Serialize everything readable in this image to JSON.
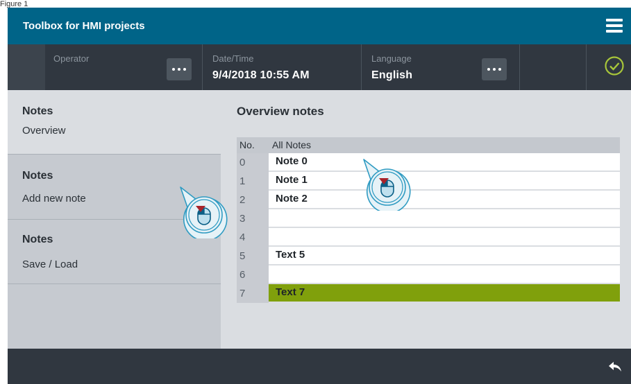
{
  "figure_label": "Figure 1",
  "app": {
    "title": "Toolbox for HMI projects"
  },
  "status": {
    "operator_label": "Operator",
    "datetime_label": "Date/Time",
    "datetime_value": "9/4/2018 10:55 AM",
    "language_label": "Language",
    "language_value": "English"
  },
  "sidebar": {
    "items": [
      {
        "heading": "Notes",
        "sub": "Overview"
      },
      {
        "heading": "Notes",
        "sub": "Add new note"
      },
      {
        "heading": "Notes",
        "sub": "Save / Load"
      }
    ]
  },
  "main": {
    "title": "Overview notes",
    "col_no": "No.",
    "col_notes": "All Notes",
    "rows": [
      {
        "no": "0",
        "text": "Note 0"
      },
      {
        "no": "1",
        "text": "Note 1"
      },
      {
        "no": "2",
        "text": "Note 2"
      },
      {
        "no": "3",
        "text": ""
      },
      {
        "no": "4",
        "text": ""
      },
      {
        "no": "5",
        "text": "Text 5"
      },
      {
        "no": "6",
        "text": ""
      },
      {
        "no": "7",
        "text": "Text 7"
      }
    ]
  },
  "colors": {
    "title_bar": "#006488",
    "status_bar": "#303740",
    "selection": "#80a00c",
    "ok_check": "#a8c63a",
    "mouse_hint": "#2f9bc2"
  },
  "icons": [
    "hamburger-menu-icon",
    "more-options-icon",
    "status-ok-check-icon",
    "back-arrow-icon",
    "mouse-click-hint-icon"
  ]
}
